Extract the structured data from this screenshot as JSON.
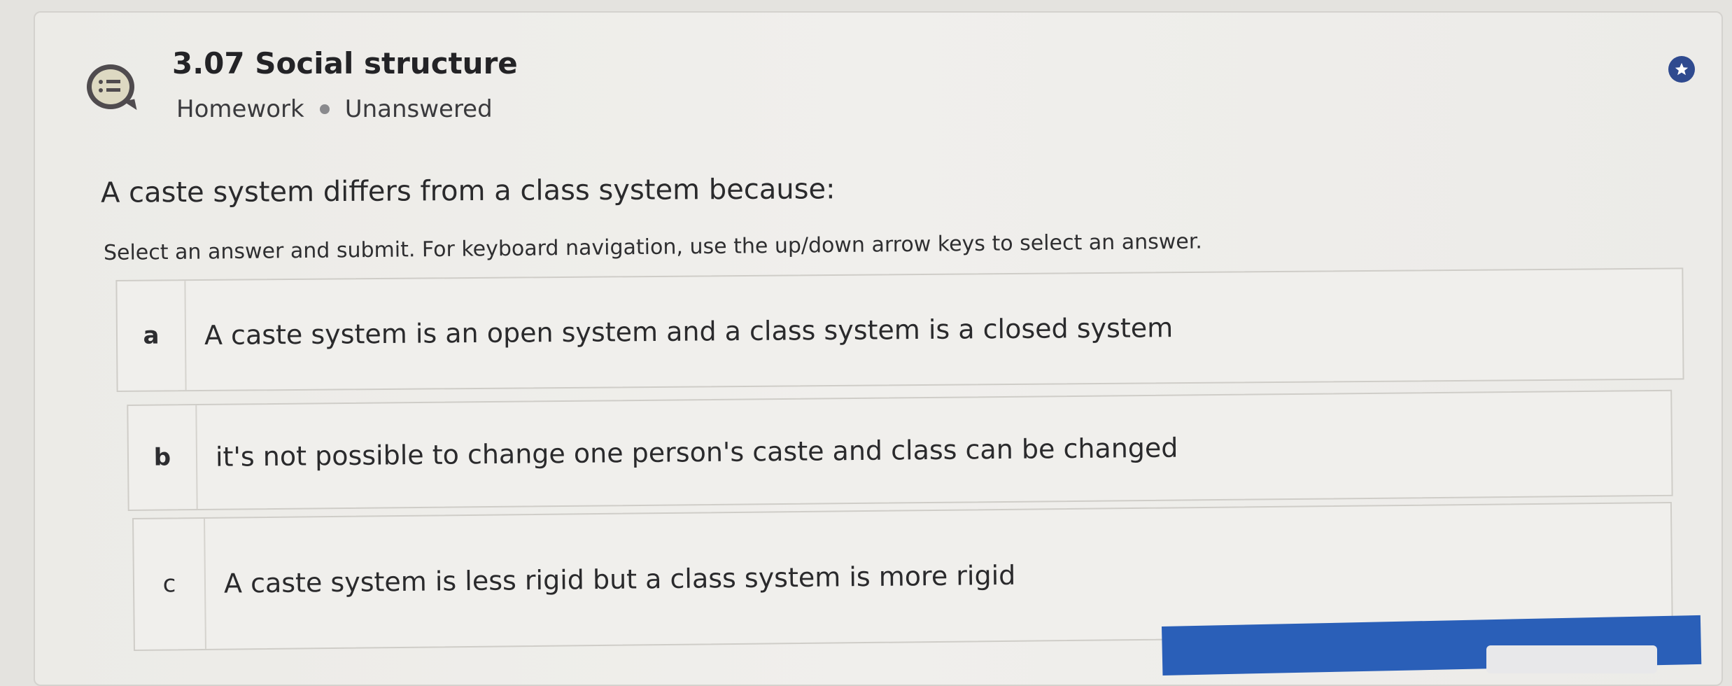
{
  "header": {
    "title": "3.07 Social structure",
    "type": "Homework",
    "status": "Unanswered",
    "icon": "list-chat-icon"
  },
  "question": {
    "text": "A caste system differs from a class system because:",
    "instructions": "Select an answer and submit. For keyboard navigation, use the up/down arrow keys to select an answer."
  },
  "options": [
    {
      "letter": "a",
      "text": "A caste system is an open system and a class system is a closed system"
    },
    {
      "letter": "b",
      "text": "it's not possible to change one person's caste and class can be changed"
    },
    {
      "letter": "c",
      "text": "A caste system is less rigid but a class system is more rigid"
    }
  ],
  "colors": {
    "accent": "#2f4a8f",
    "action_bar": "#2a5fb8"
  }
}
